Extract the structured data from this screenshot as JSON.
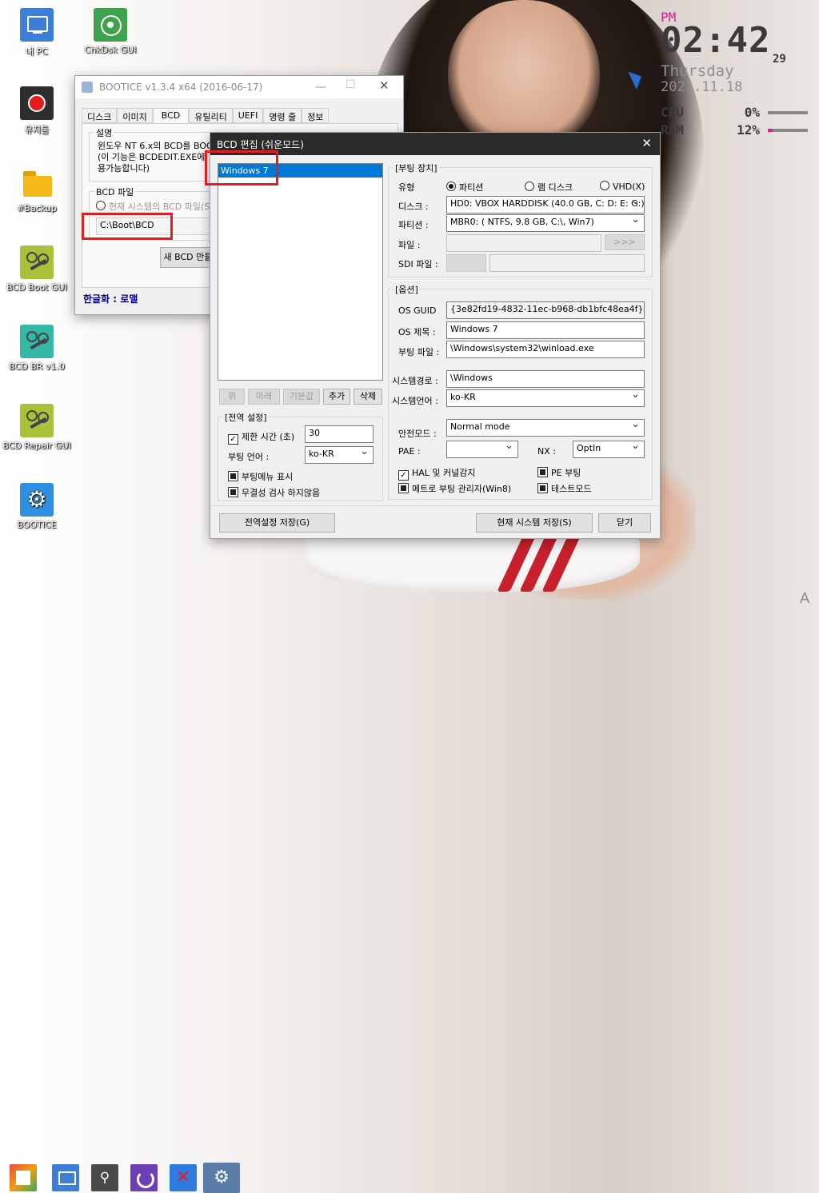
{
  "desktop": {
    "icons": [
      {
        "label": "내 PC",
        "icon": "monitor-icon"
      },
      {
        "label": "ChkDsk GUI",
        "icon": "disk-icon"
      },
      {
        "label": "유지툴",
        "icon": "record-icon"
      },
      {
        "label": "#Backup",
        "icon": "folder-icon"
      },
      {
        "label": "BCD Boot GUI",
        "icon": "tool-icon"
      },
      {
        "label": "BCD BR v1.0",
        "icon": "tool-icon"
      },
      {
        "label": "BCD Repair GUI",
        "icon": "tool-icon"
      },
      {
        "label": "BOOTICE",
        "icon": "gear-icon"
      }
    ]
  },
  "clock": {
    "ampm": "PM",
    "time": "02:42",
    "seconds": "29",
    "day": "Thursday",
    "date": "2021.11.18",
    "cpu_label": "CPU",
    "cpu_value": "0%",
    "cpu_level": 0,
    "ram_label": "RAM",
    "ram_value": "12%",
    "ram_level": 0.12,
    "accent": "#e0189a"
  },
  "bootice": {
    "title": "BOOTICE v1.3.4 x64 (2016-06-17)",
    "tabs": [
      "디스크",
      "이미지",
      "BCD",
      "유틸리티",
      "UEFI",
      "명령 줄",
      "정보"
    ],
    "active_tab": "BCD",
    "desc_group": "설명",
    "desc_line1": "윈도우 NT 6.x의 BCD를 BOOT",
    "desc_line2": "(이 기능은 BCDEDIT.EXE에 ",
    "desc_line3": "용가능합니다)",
    "bcd_file_group": "BCD 파일",
    "current_system_radio": "현재 시스템의 BCD 파일(S)",
    "bcd_path": "C:\\Boot\\BCD",
    "new_bcd_button": "새 BCD 만들기",
    "credit": "한글화 : 로맬"
  },
  "bcd_edit": {
    "title": "BCD 편집 (쉬운모드)",
    "entries": [
      "Windows 7"
    ],
    "list_buttons": {
      "up": "위",
      "down": "아래",
      "default": "기본값",
      "add": "추가",
      "delete": "삭제"
    },
    "global_group": "[전역 설정]",
    "timeout_label": "제한 시간 (초)",
    "timeout_value": "30",
    "boot_lang_label": "부팅 언어 :",
    "boot_lang_value": "ko-KR",
    "show_menu_label": "부팅메뉴 표시",
    "no_integrity_label": "무결성 검사 하지않음",
    "boot_device_group": "[부팅 장치]",
    "type_label": "유형",
    "type_options": [
      "파티션",
      "램 디스크",
      "VHD(X)"
    ],
    "type_selected": "파티션",
    "disk_label": "디스크 :",
    "disk_value": "HD0: VBOX HARDDISK (40.0 GB, C: D: E: G:)",
    "partition_label": "파티션 :",
    "partition_value": "MBR0: ( NTFS,  9.8 GB, C:\\, Win7)",
    "file_label": "파일 :",
    "file_browse": ">>>",
    "sdi_label": "SDI 파일 :",
    "options_group": "[옵션]",
    "os_guid_label": "OS GUID",
    "os_guid_value": "{3e82fd19-4832-11ec-b968-db1bfc48ea4f}",
    "os_title_label": "OS 제목 :",
    "os_title_value": "Windows 7",
    "boot_file_label": "부팅 파일 :",
    "boot_file_value": "\\Windows\\system32\\winload.exe",
    "sys_path_label": "시스템경로 :",
    "sys_path_value": "\\Windows",
    "sys_lang_label": "시스템언어 :",
    "sys_lang_value": "ko-KR",
    "safe_mode_label": "안전모드 :",
    "safe_mode_value": "Normal mode",
    "pae_label": "PAE :",
    "pae_value": "",
    "nx_label": "NX :",
    "nx_value": "OptIn",
    "hal_label": "HAL 및 커널감지",
    "pe_boot_label": "PE 부팅",
    "metro_label": "메트로 부팅 관리자(Win8)",
    "test_mode_label": "테스트모드",
    "save_global": "전역설정 저장(G)",
    "save_system": "현재 시스템 저장(S)",
    "close": "닫기"
  },
  "taskbar": [
    "start-icon",
    "monitor-icon",
    "search-icon",
    "refresh-icon",
    "close-x-icon",
    "gear-icon"
  ],
  "watermark": "A"
}
